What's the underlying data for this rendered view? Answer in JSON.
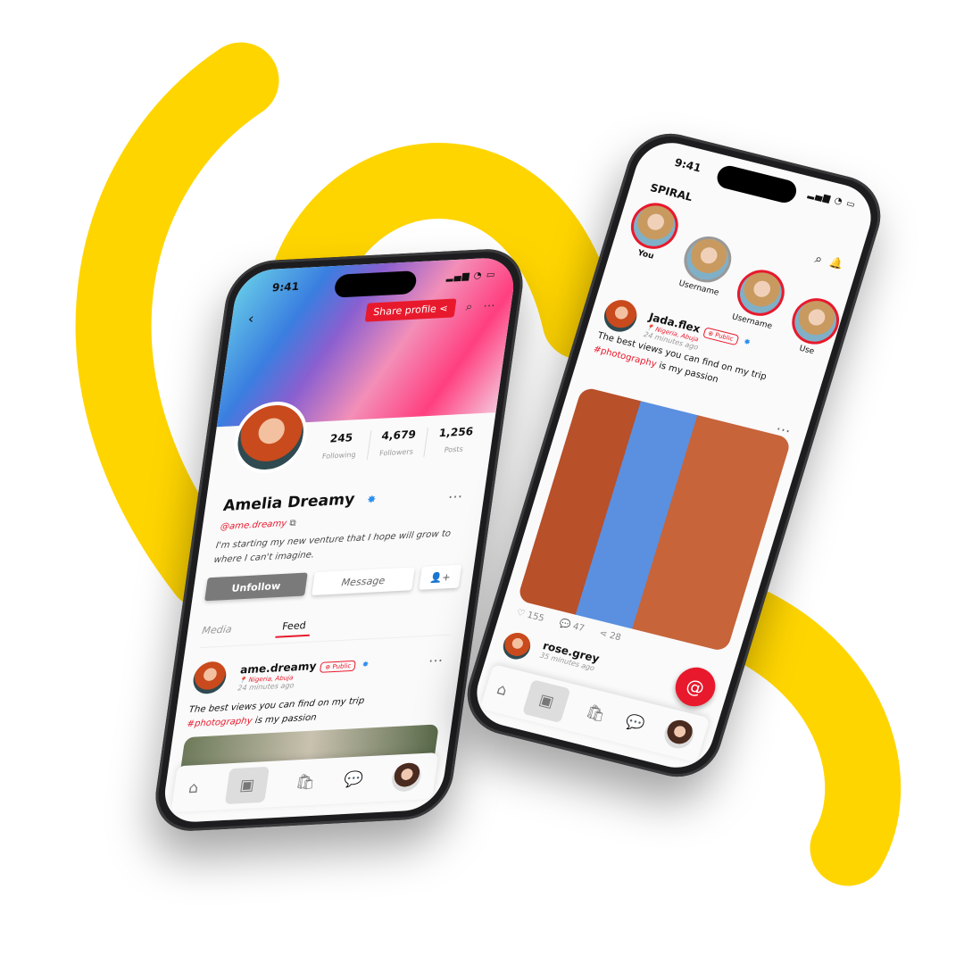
{
  "colors": {
    "accent": "#e8192c",
    "brand_yellow": "#FFD500",
    "verified": "#2b8ff0"
  },
  "profile_phone": {
    "status_time": "9:41",
    "share_profile": "Share profile",
    "stats": [
      {
        "value": "245",
        "label": "Following"
      },
      {
        "value": "4,679",
        "label": "Followers"
      },
      {
        "value": "1,256",
        "label": "Posts"
      }
    ],
    "name": "Amelia Dreamy",
    "handle": "@ame.dreamy",
    "bio": "I'm starting my new venture that I hope will grow to where I can't imagine.",
    "unfollow": "Unfollow",
    "message": "Message",
    "tabs": [
      {
        "label": "Media",
        "active": false
      },
      {
        "label": "Feed",
        "active": true
      }
    ],
    "post": {
      "user": "ame.dreamy",
      "visibility": "Public",
      "location": "Nigeria, Abuja",
      "time": "24 minutes ago",
      "text": "The best views you can find on my trip",
      "hashtag": "#photography",
      "text2": "is my passion"
    },
    "nav": [
      "home-icon",
      "feed-icon",
      "shop-icon",
      "chat-icon",
      "profile-avatar"
    ]
  },
  "feed_phone": {
    "status_time": "9:41",
    "app_name": "SPIRAL",
    "stories": [
      {
        "label": "You"
      },
      {
        "label": "Username"
      },
      {
        "label": "Username"
      },
      {
        "label": "Use"
      }
    ],
    "post": {
      "user": "Jada.flex",
      "visibility": "Public",
      "location": "Nigeria, Abuja",
      "time": "24 minutes ago",
      "text": "The best views you can find on my trip",
      "hashtag": "#photography",
      "text2": "is my passion",
      "likes": "155",
      "comments": "47",
      "shares": "28"
    },
    "next_post": {
      "user": "rose.grey",
      "time": "35 minutes ago"
    }
  }
}
